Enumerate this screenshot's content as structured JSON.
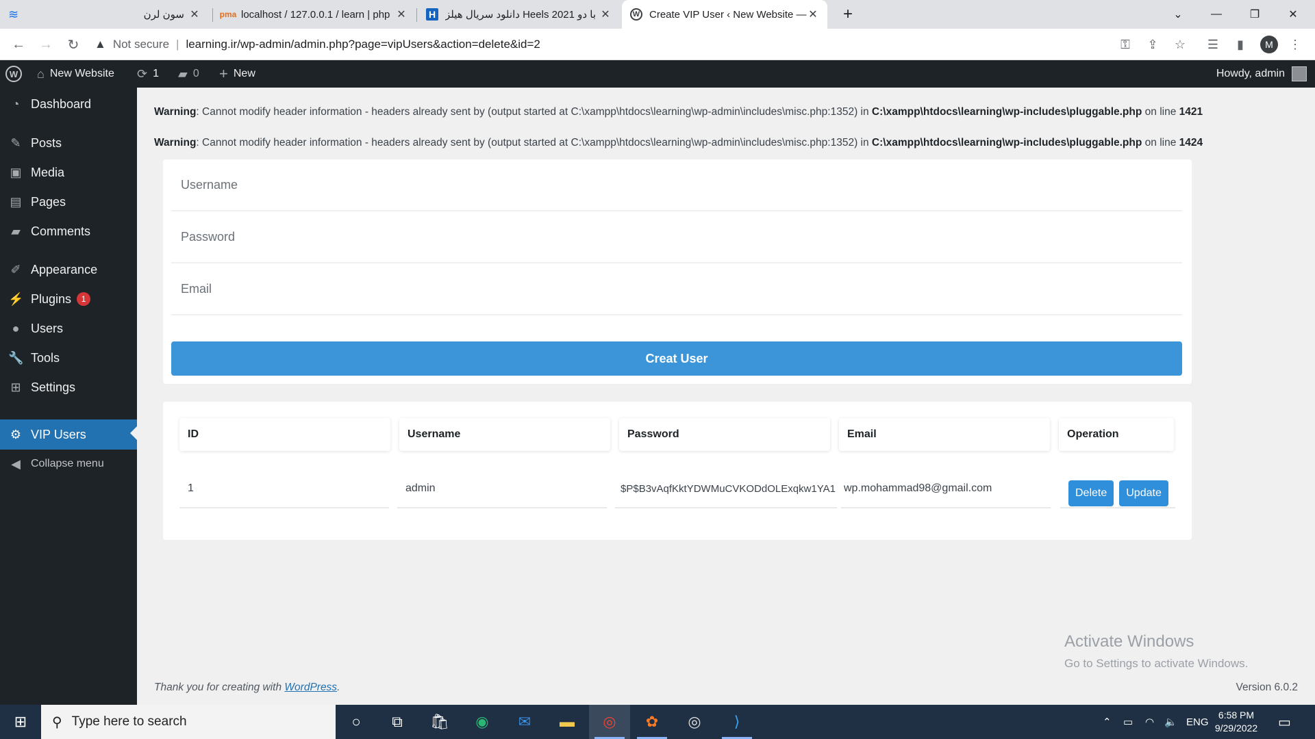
{
  "browser": {
    "tabs": [
      {
        "title": "سون لرن",
        "active": false
      },
      {
        "title": "localhost / 127.0.0.1 / learn | php",
        "active": false
      },
      {
        "title": "دانلود سریال هیلز Heels 2021 با دو",
        "active": false
      },
      {
        "title": "Create VIP User ‹ New Website —",
        "active": true
      }
    ],
    "new_tab": "+",
    "security_label": "Not secure",
    "url": "learning.ir/wp-admin/admin.php?page=vipUsers&action=delete&id=2",
    "profile_initial": "M"
  },
  "adminbar": {
    "site_name": "New Website",
    "updates_count": "1",
    "comments_count": "0",
    "new_label": "New",
    "greeting": "Howdy, admin"
  },
  "sidebar": {
    "items": [
      {
        "label": "Dashboard",
        "icon": "dashboard-icon"
      },
      {
        "label": "Posts",
        "icon": "pin-icon"
      },
      {
        "label": "Media",
        "icon": "media-icon"
      },
      {
        "label": "Pages",
        "icon": "page-icon"
      },
      {
        "label": "Comments",
        "icon": "comment-icon"
      },
      {
        "label": "Appearance",
        "icon": "brush-icon"
      },
      {
        "label": "Plugins",
        "icon": "plugin-icon",
        "badge": "1"
      },
      {
        "label": "Users",
        "icon": "user-icon"
      },
      {
        "label": "Tools",
        "icon": "wrench-icon"
      },
      {
        "label": "Settings",
        "icon": "settings-icon"
      },
      {
        "label": "VIP Users",
        "icon": "gear-icon",
        "current": true
      }
    ],
    "collapse_label": "Collapse menu"
  },
  "warnings": [
    {
      "label": "Warning",
      "text": ": Cannot modify header information - headers already sent by (output started at C:\\xampp\\htdocs\\learning\\wp-admin\\includes\\misc.php:1352) in ",
      "file": "C:\\xampp\\htdocs\\learning\\wp-includes\\pluggable.php",
      "on_line": " on line ",
      "line": "1421"
    },
    {
      "label": "Warning",
      "text": ": Cannot modify header information - headers already sent by (output started at C:\\xampp\\htdocs\\learning\\wp-admin\\includes\\misc.php:1352) in ",
      "file": "C:\\xampp\\htdocs\\learning\\wp-includes\\pluggable.php",
      "on_line": " on line ",
      "line": "1424"
    }
  ],
  "form": {
    "username_placeholder": "Username",
    "password_placeholder": "Password",
    "email_placeholder": "Email",
    "submit_label": "Creat User"
  },
  "table": {
    "headers": [
      "ID",
      "Username",
      "Password",
      "Email",
      "Operation"
    ],
    "rows": [
      {
        "id": "1",
        "username": "admin",
        "password": "$P$B3vAqfKktYDWMuCVKODdOLExqkw1YA1",
        "email": "wp.mohammad98@gmail.com"
      }
    ],
    "delete_label": "Delete",
    "update_label": "Update"
  },
  "footer": {
    "thanks_prefix": "Thank you for creating with ",
    "thanks_link": "WordPress",
    "thanks_suffix": ".",
    "version": "Version 6.0.2"
  },
  "watermark": {
    "line1": "Activate Windows",
    "line2": "Go to Settings to activate Windows."
  },
  "taskbar": {
    "search_placeholder": "Type here to search",
    "language": "ENG",
    "time": "6:58 PM",
    "date": "9/29/2022"
  },
  "colors": {
    "wp_dark": "#1d2327",
    "wp_blue": "#2271b1",
    "button_blue": "#3b95d8",
    "badge_red": "#d63638"
  }
}
